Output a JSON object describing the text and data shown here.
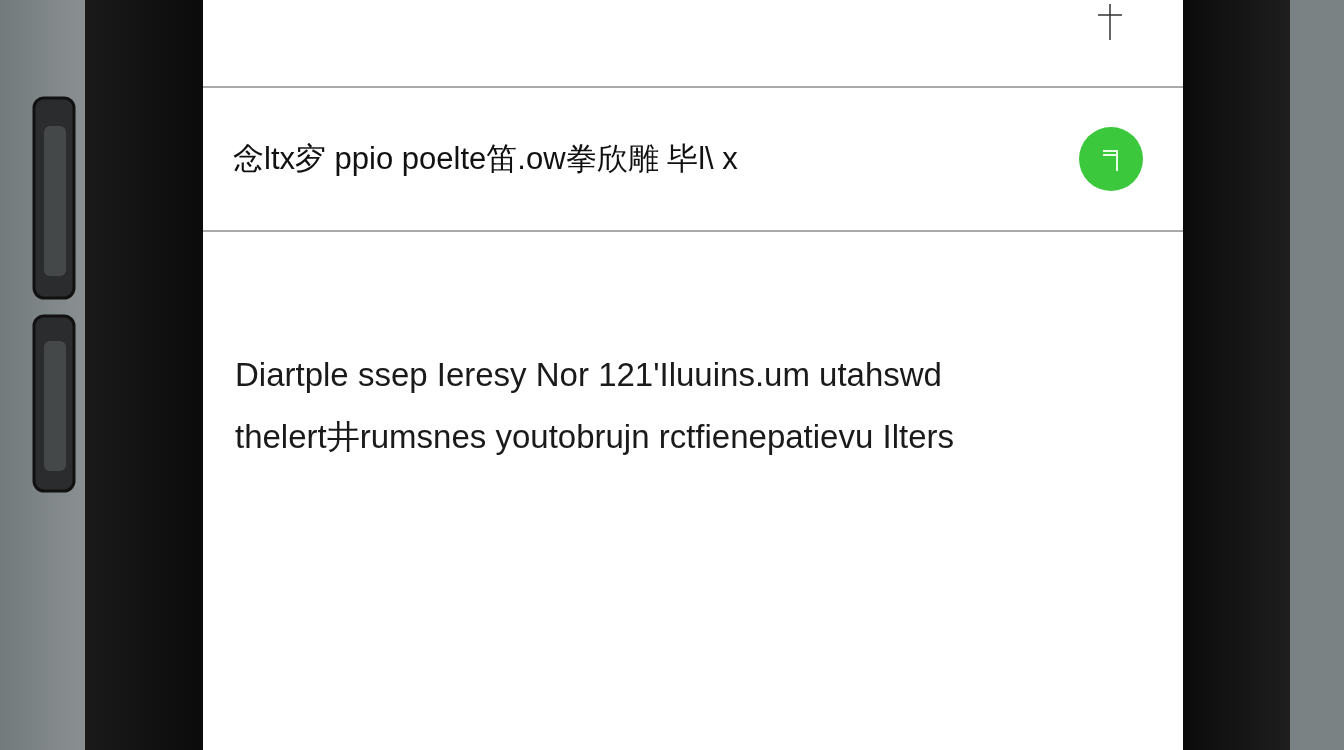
{
  "list_item": {
    "text": "念ltx穸 ppio poelte笛.ow拳欣雕 毕l\\ x"
  },
  "message": {
    "lines": [
      "Diartple ssep Ieresy Nor 121'Iluuins.um utahswd",
      "thelert井rumsnes youtobrujn rctfienepatievu Ilters"
    ]
  }
}
